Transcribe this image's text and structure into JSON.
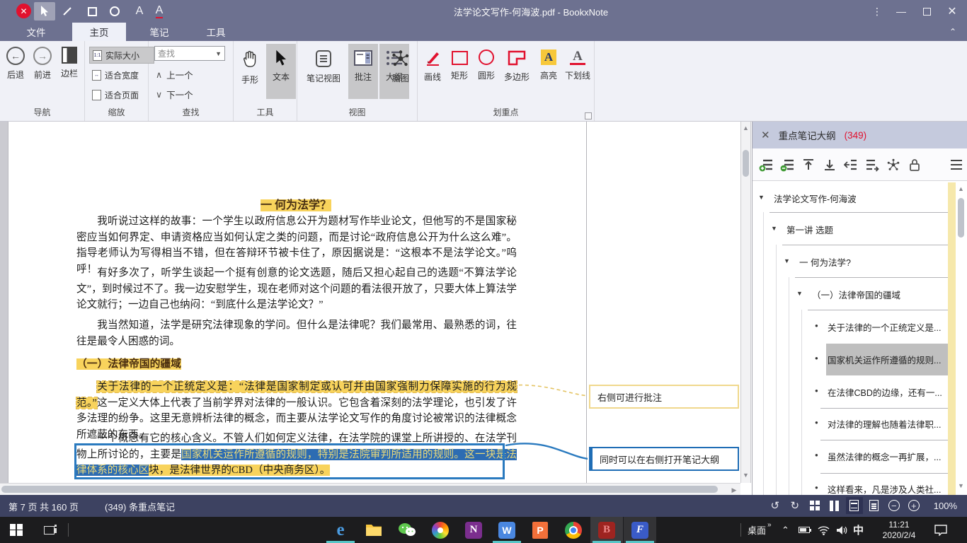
{
  "titlebar": {
    "title": "法学论文写作-何海波.pdf - BookxNote"
  },
  "tabs": {
    "file": "文件",
    "home": "主页",
    "note": "笔记",
    "tool": "工具"
  },
  "ribbon": {
    "nav": {
      "back": "后退",
      "forward": "前进",
      "sidebar": "边栏",
      "label": "导航"
    },
    "zoom": {
      "actual": "实际大小",
      "fit_width": "适合宽度",
      "fit_page": "适合页面",
      "label": "缩放"
    },
    "find": {
      "placeholder": "查找",
      "prev": "上一个",
      "next": "下一个",
      "label": "查找"
    },
    "tools": {
      "hand": "手形",
      "text": "文本",
      "label": "工具"
    },
    "view": {
      "note_view": "笔记视图",
      "annotate": "批注",
      "outline": "大纲",
      "mindmap": "脑图",
      "label": "视图"
    },
    "hl": {
      "draw": "画线",
      "rect": "矩形",
      "circle": "圆形",
      "polygon": "多边形",
      "highlight": "高亮",
      "underline": "下划线",
      "label": "划重点"
    }
  },
  "doc": {
    "title": "一 何为法学？",
    "p1": "我听说过这样的故事：一个学生以政府信息公开为题材写作毕业论文，但他写的不是国家秘密应当如何界定、申请资格应当如何认定之类的问题，而是讨论“政府信息公开为什么这么难”。指导老师认为写得相当不错，但在答辩环节被卡住了，原因据说是：“这根本不是法学论文。”呜呼！",
    "p2": "有好多次了，听学生谈起一个挺有创意的论文选题，随后又担心起自己的选题“不算法学论文”，到时候过不了。我一边安慰学生，现在老师对这个问题的看法很开放了，只要大体上算法学论文就行；一边自己也纳闷：“到底什么是法学论文？”",
    "p3": "我当然知道，法学是研究法律现象的学问。但什么是法律呢？我们最常用、最熟悉的词，往往是最令人困惑的词。",
    "h2": "（一）法律帝国的疆域",
    "p4_hl": "关于法律的一个正统定义是：“法律是国家制定或认可并由国家强制力保障实施的行为规范。”",
    "p4_rest": "这一定义大体上代表了当前学界对法律的一般认识。它包含着深刻的法学理论，也引发了许多法理的纷争。这里无意辨析法律的概念，而主要从法学论文写作的角度讨论被常识的法律概念所遮蔽的东西。",
    "p5_normal": "一个概念有它的核心含义。不管人们如何定义法律，在法学院的课堂上所讲授的、在法学刊物上所讨论的，主要是",
    "p5_selected": "国家机关运作所遵循的规则，特别是法院审判所适用的规则。这一块是法律体系的核心区",
    "p5_hl": "块，是法律世界的CBD（中央商务区）。"
  },
  "annotations": {
    "note1": "右侧可进行批注",
    "note2": "同时可以在右侧打开笔记大纲"
  },
  "outline": {
    "title": "重点笔记大纲",
    "count": "(349)",
    "tree": [
      {
        "label": "法学论文写作-何海波"
      },
      {
        "label": "第一讲 选题"
      },
      {
        "label": "一 何为法学?"
      },
      {
        "label": "（一）法律帝国的疆域"
      },
      {
        "label": "关于法律的一个正统定义是..."
      },
      {
        "label": "国家机关运作所遵循的规则..."
      },
      {
        "label": "在法律CBD的边缘，还有一..."
      },
      {
        "label": "对法律的理解也随着法律职..."
      },
      {
        "label": "虽然法律的概念一再扩展，..."
      },
      {
        "label": "这样看来，凡是涉及人类社..."
      }
    ]
  },
  "statusbar": {
    "page_info": "第 7 页 共 160 页",
    "notes_info": "(349) 条重点笔记",
    "zoom_level": "100%"
  },
  "taskbar": {
    "desktop": "桌面",
    "ime": "中",
    "time": "11:21",
    "date": "2020/2/4"
  },
  "colors": {
    "accent_red": "#e1112e",
    "highlight_yellow": "#f8d35c",
    "annotation_blue": "#2a7abf",
    "titlebar": "#6d7190",
    "selection_blue": "#2d6cb2",
    "run_indicator": "#58c6c8"
  }
}
